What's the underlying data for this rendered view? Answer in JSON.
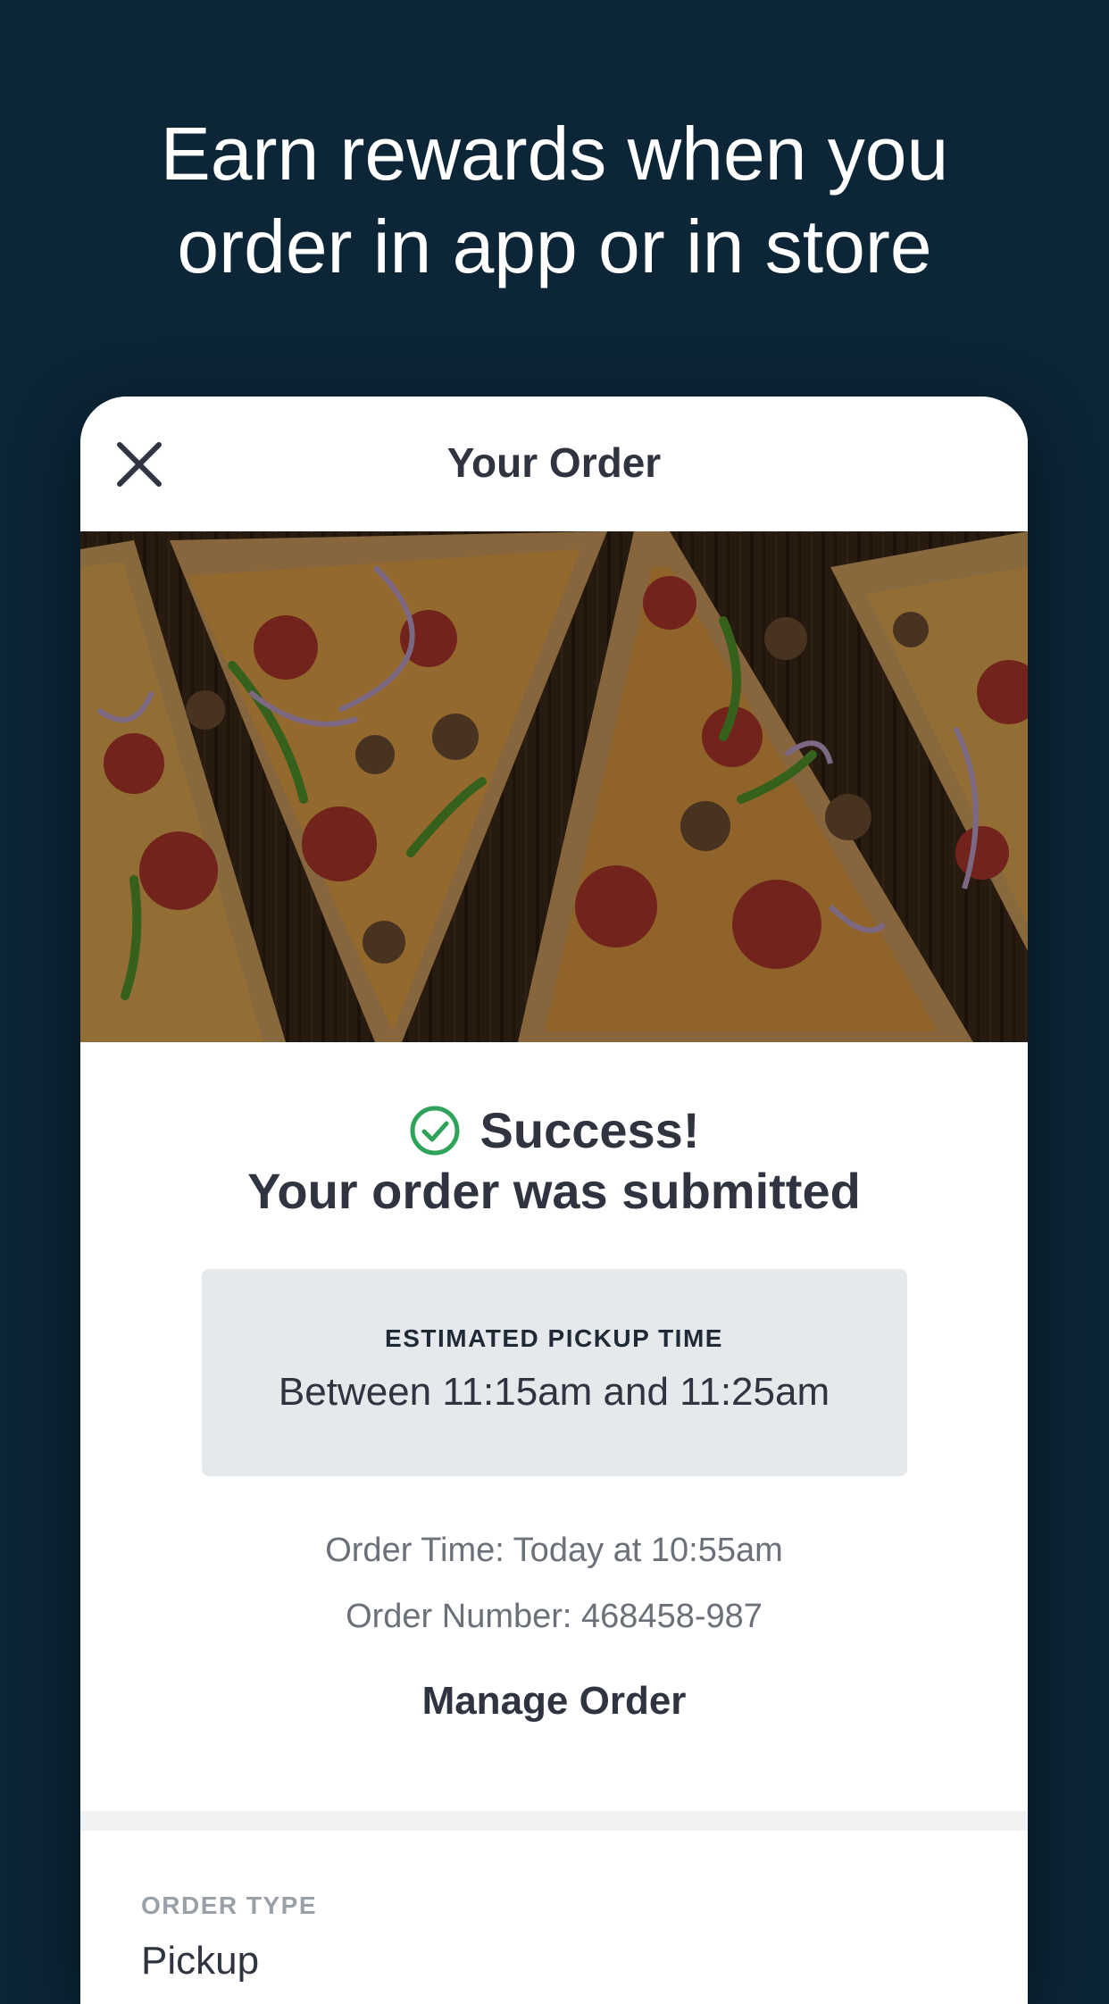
{
  "headline": {
    "line1": "Earn rewards when you",
    "line2": "order in app or in store"
  },
  "modal": {
    "title": "Your Order",
    "close_icon": "close-icon"
  },
  "hero": {
    "icon": "pizza-photo"
  },
  "confirmation": {
    "status_icon": "check-circle-icon",
    "status_color": "#2fa35a",
    "success": "Success!",
    "message": "Your order was submitted"
  },
  "pickup": {
    "label": "ESTIMATED PICKUP TIME",
    "value": "Between 11:15am and 11:25am"
  },
  "order": {
    "time": "Order Time: Today at 10:55am",
    "number": "Order Number: 468458-987"
  },
  "actions": {
    "manage": "Manage Order"
  },
  "details": {
    "type_label": "ORDER TYPE",
    "type_value": "Pickup"
  },
  "colors": {
    "background": "#0c2537",
    "text_dark": "#2f3440",
    "muted": "#6b7079",
    "box": "#e6e9eb"
  }
}
